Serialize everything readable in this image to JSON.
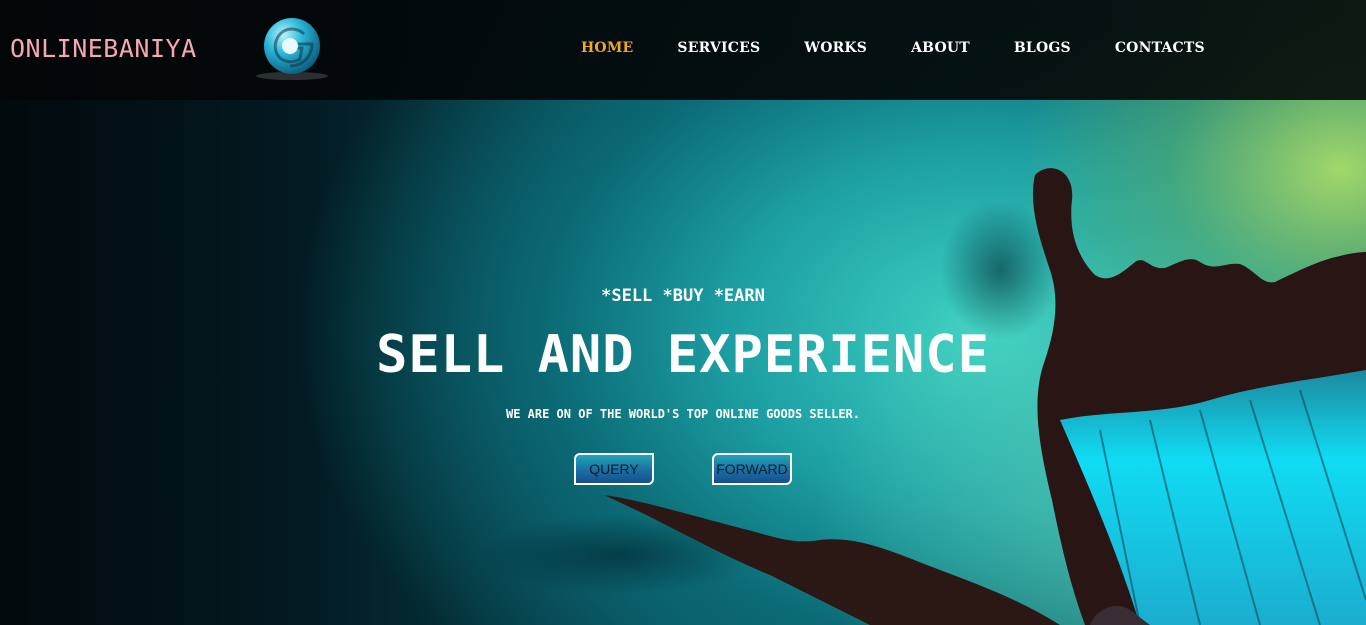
{
  "brand": {
    "name": "ONLINEBANIYA",
    "logo_icon": "g-logo-icon"
  },
  "nav": {
    "items": [
      {
        "label": "HOME",
        "active": true
      },
      {
        "label": "SERVICES",
        "active": false
      },
      {
        "label": "WORKS",
        "active": false
      },
      {
        "label": "ABOUT",
        "active": false
      },
      {
        "label": "BLOGS",
        "active": false
      },
      {
        "label": "CONTACTS",
        "active": false
      }
    ]
  },
  "hero": {
    "kicker": "*SELL *BUY *EARN",
    "title": "SELL AND EXPERIENCE",
    "subtitle": "WE ARE ON OF THE WORLD'S TOP ONLINE GOODS SELLER.",
    "buttons": {
      "query_label": "QUERY",
      "forward_label": "FORWARD"
    },
    "background_image": "butterfly"
  },
  "colors": {
    "brand_text": "#f6a7b3",
    "nav_active": "#f5a623",
    "nav_text": "#ffffff",
    "hero_text": "#ffffff"
  }
}
